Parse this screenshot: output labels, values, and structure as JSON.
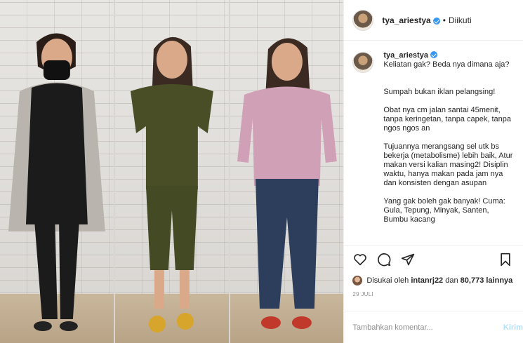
{
  "header": {
    "username": "tya_ariestya",
    "separator": "•",
    "follow_status": "Diikuti"
  },
  "caption": {
    "username": "tya_ariestya",
    "paragraphs": [
      "Keliatan gak? Beda nya dimana aja?",
      "Sumpah bukan iklan pelangsing!",
      "Obat nya cm jalan santai 45menit, tanpa keringetan, tanpa capek, tanpa ngos ngos an",
      "Tujuannya merangsang sel utk bs bekerja (metabolisme) lebih baik, Atur makan versi kalian masing2! Disiplin waktu, hanya makan pada jam nya dan konsisten dengan asupan",
      "Yang gak boleh gak banyak! Cuma: Gula, Tepung, Minyak, Santen, Bumbu kacang"
    ]
  },
  "likes": {
    "prefix": "Disukai oleh",
    "user": "intanrj22",
    "middle": "dan",
    "count": "80,773 lainnya"
  },
  "date": "29 JULI",
  "comment": {
    "placeholder": "Tambahkan komentar...",
    "send_label": "Kirim"
  },
  "colors": {
    "verified": "#3897f0",
    "outfit_left": "#1b1b1b",
    "outfit_middle": "#4a4e27",
    "outfit_right_top": "#cfa0b6",
    "outfit_right_jeans": "#2c3e5c"
  }
}
